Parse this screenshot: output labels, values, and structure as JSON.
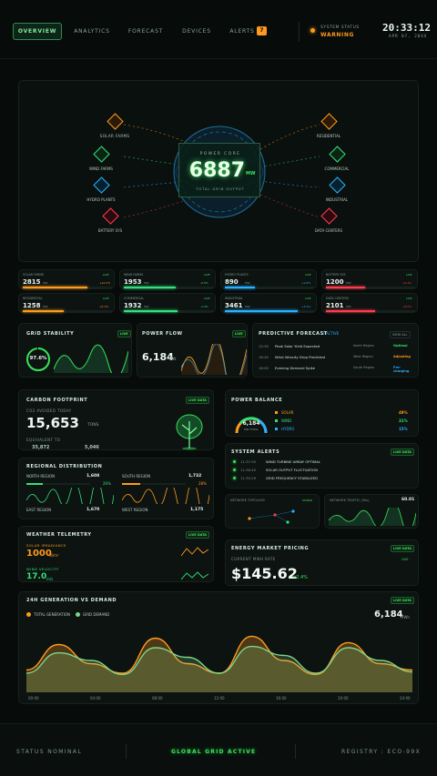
{
  "nav": {
    "tabs": [
      {
        "label": "OVERVIEW"
      },
      {
        "label": "ANALYTICS"
      },
      {
        "label": "FORECAST"
      },
      {
        "label": "DEVICES"
      },
      {
        "label": "ALERTS",
        "badge": "7"
      }
    ],
    "status_label": "SYSTEM STATUS",
    "status_value": "WARNING",
    "time": "20:33:12",
    "date": "APR 07, 20XX"
  },
  "core": {
    "title": "POWER CORE",
    "value": "6887",
    "unit": "MW",
    "subtitle": "TOTAL GRID OUTPUT",
    "sources": [
      {
        "label": "SOLAR FARMS",
        "icon": "solar-panel-icon"
      },
      {
        "label": "WIND FARMS",
        "icon": "wind-turbine-icon"
      },
      {
        "label": "HYDRO PLANTS",
        "icon": "water-drop-icon"
      },
      {
        "label": "BATTERY SYS",
        "icon": "battery-icon"
      }
    ],
    "sinks": [
      {
        "label": "RESIDENTIAL",
        "icon": "house-icon"
      },
      {
        "label": "COMMERCIAL",
        "icon": "building-icon"
      },
      {
        "label": "INDUSTRIAL",
        "icon": "factory-icon"
      },
      {
        "label": "DATA CENTERS",
        "icon": "server-icon"
      }
    ]
  },
  "metrics_top": [
    {
      "label": "SOLAR FARMS",
      "value": "2815",
      "unit": "MW",
      "delta": "+12.3%",
      "color": "#ff9a1f",
      "fill": 0.72
    },
    {
      "label": "WIND FARMS",
      "value": "1953",
      "unit": "MW",
      "delta": "-0.5%",
      "color": "#33e07a",
      "fill": 0.58
    },
    {
      "label": "HYDRO PLANTS",
      "value": "890",
      "unit": "MW",
      "delta": "+1.8%",
      "color": "#2ab0ff",
      "fill": 0.34
    },
    {
      "label": "BATTERY SYS",
      "value": "1200",
      "unit": "MW",
      "delta": "+2.4%",
      "color": "#ff3b4e",
      "fill": 0.44
    }
  ],
  "metrics_bottom": [
    {
      "label": "RESIDENTIAL",
      "value": "1258",
      "unit": "MW",
      "delta": "+5.1%",
      "color": "#ff9a1f",
      "fill": 0.46
    },
    {
      "label": "COMMERCIAL",
      "value": "1932",
      "unit": "MW",
      "delta": "-1.4%",
      "color": "#33e07a",
      "fill": 0.6
    },
    {
      "label": "INDUSTRIAL",
      "value": "3461",
      "unit": "MW",
      "delta": "+3.2%",
      "color": "#2ab0ff",
      "fill": 0.82
    },
    {
      "label": "DATA CENTERS",
      "value": "2101",
      "unit": "MW",
      "delta": "+6.0%",
      "color": "#ff3b4e",
      "fill": 0.55
    }
  ],
  "grid_stability": {
    "title": "GRID STABILITY",
    "badge": "LIVE",
    "value": "97.6%"
  },
  "power_flow": {
    "title": "POWER FLOW",
    "badge": "LIVE",
    "value": "6,184",
    "unit": "MW"
  },
  "forecast": {
    "title": "PREDICTIVE FORECAST",
    "active": "3 ACTIVE",
    "view_all": "VIEW ALL",
    "rows": [
      {
        "time": "15:30",
        "text": "Peak Solar Yield Expected",
        "region": "North Region",
        "status": "Optimal",
        "color": "#37e45a"
      },
      {
        "time": "16:45",
        "text": "Wind Velocity Drop Predicted",
        "region": "West Region",
        "status": "Adjusting",
        "color": "#ff9a1f"
      },
      {
        "time": "18:00",
        "text": "Evening Demand Spike",
        "region": "South Region",
        "status": "Pre-charging",
        "color": "#2ab0ff"
      }
    ]
  },
  "carbon": {
    "title": "CARBON FOOTPRINT",
    "badge": "LIVE DATA",
    "sub": "CO2 AVOIDED TODAY",
    "value": "15,653",
    "unit": "TONS",
    "eq_label": "EQUIVALENT TO",
    "eq1": "35,872",
    "eq2": "5,046"
  },
  "balance": {
    "title": "POWER BALANCE",
    "value": "6,184",
    "unit": "MW TOTAL",
    "items": [
      {
        "label": "SOLAR",
        "pct": "49%",
        "color": "#ff9a1f"
      },
      {
        "label": "WIND",
        "pct": "31%",
        "color": "#33e07a"
      },
      {
        "label": "HYDRO",
        "pct": "15%",
        "color": "#2ab0ff"
      }
    ]
  },
  "regional": {
    "title": "REGIONAL DISTRIBUTION",
    "regions": [
      {
        "label": "NORTH REGION",
        "value": "1,608",
        "unit": "MW",
        "pct": "26%",
        "color": "#33e07a"
      },
      {
        "label": "SOUTH REGION",
        "value": "1,732",
        "unit": "MW",
        "pct": "28%",
        "color": "#ff9a1f"
      },
      {
        "label": "EAST REGION",
        "value": "1,670",
        "unit": "MW",
        "color": "#33e07a"
      },
      {
        "label": "WEST REGION",
        "value": "1,175",
        "unit": "MW",
        "color": "#ff9a1f"
      }
    ]
  },
  "alerts": {
    "title": "SYSTEM ALERTS",
    "badge": "LIVE DATA",
    "rows": [
      {
        "time": "11:37:35",
        "text": "WIND TURBINE ARRAY OPTIMAL"
      },
      {
        "time": "11:36:45",
        "text": "SOLAR OUTPUT FLUCTUATION"
      },
      {
        "time": "11:35:29",
        "text": "GRID FREQUENCY STABILIZED"
      }
    ]
  },
  "mini": {
    "map_title": "NETWORK TOPOLOGY",
    "map_badge": "STABLE",
    "traffic_title": "NETWORK TRAFFIC (30s)",
    "traffic_value": "60.01"
  },
  "weather": {
    "title": "WEATHER TELEMETRY",
    "badge": "LIVE DATA",
    "solar_label": "SOLAR IRRADIANCE",
    "solar_value": "1000",
    "solar_unit": "W/m²",
    "wind_label": "WIND VELOCITY",
    "wind_value": "17.0",
    "wind_unit": "m/s"
  },
  "pricing": {
    "title": "ENERGY MARKET PRICING",
    "badge": "LIVE DATA",
    "sub": "CURRENT MWh RATE",
    "live": "LIVE",
    "value": "$145.62",
    "delta": "+2.4%"
  },
  "chart_panel": {
    "title": "24H GENERATION VS DEMAND",
    "badge": "LIVE DATA",
    "legend_gen": "TOTAL GENERATION",
    "legend_dem": "GRID DEMAND",
    "value": "6,184",
    "unit": "MWh"
  },
  "chart_data": {
    "type": "area",
    "title": "24H GENERATION VS DEMAND",
    "x": [
      "00:00",
      "04:00",
      "08:00",
      "12:00",
      "16:00",
      "20:00",
      "24:00"
    ],
    "series": [
      {
        "name": "TOTAL GENERATION",
        "color": "#ff9a1f",
        "values": [
          0.35,
          0.75,
          0.45,
          0.3,
          0.85,
          0.45,
          0.3,
          0.88,
          0.5,
          0.28,
          0.78,
          0.45,
          0.35
        ]
      },
      {
        "name": "GRID DEMAND",
        "color": "#7fd48a",
        "values": [
          0.3,
          0.62,
          0.5,
          0.28,
          0.7,
          0.55,
          0.3,
          0.72,
          0.58,
          0.3,
          0.7,
          0.5,
          0.32
        ]
      }
    ]
  },
  "footer": {
    "left": "STATUS NOMINAL",
    "center": "GLOBAL GRID ACTIVE",
    "right": "REGISTRY : ECO-99X"
  }
}
